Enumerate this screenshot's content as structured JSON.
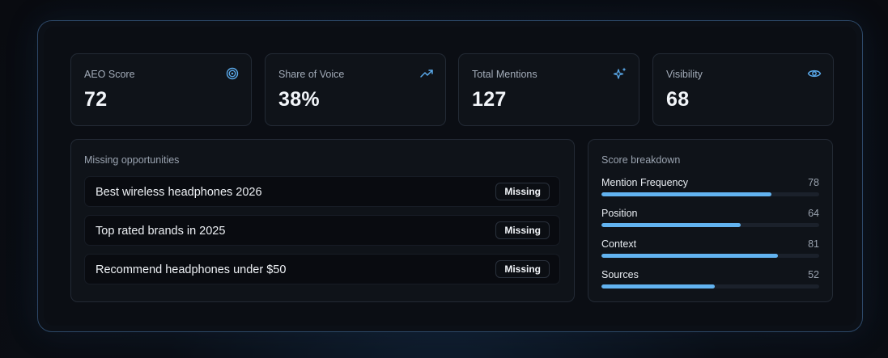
{
  "stats": [
    {
      "label": "AEO Score",
      "value": "72",
      "icon": "target-icon"
    },
    {
      "label": "Share of Voice",
      "value": "38%",
      "icon": "trending-up-icon"
    },
    {
      "label": "Total Mentions",
      "value": "127",
      "icon": "sparkles-icon"
    },
    {
      "label": "Visibility",
      "value": "68",
      "icon": "eye-icon"
    }
  ],
  "opportunities": {
    "title": "Missing opportunities",
    "items": [
      {
        "text": "Best wireless headphones 2026",
        "status": "Missing"
      },
      {
        "text": "Top rated brands in 2025",
        "status": "Missing"
      },
      {
        "text": "Recommend headphones under $50",
        "status": "Missing"
      }
    ]
  },
  "breakdown": {
    "title": "Score breakdown",
    "items": [
      {
        "label": "Mention Frequency",
        "value": "78",
        "fraction": 0.78
      },
      {
        "label": "Position",
        "value": "64",
        "fraction": 0.64
      },
      {
        "label": "Context",
        "value": "81",
        "fraction": 0.81
      },
      {
        "label": "Sources",
        "value": "52",
        "fraction": 0.52
      }
    ]
  },
  "colors": {
    "accent": "#62b3f0",
    "icon": "#5aa9ea"
  }
}
